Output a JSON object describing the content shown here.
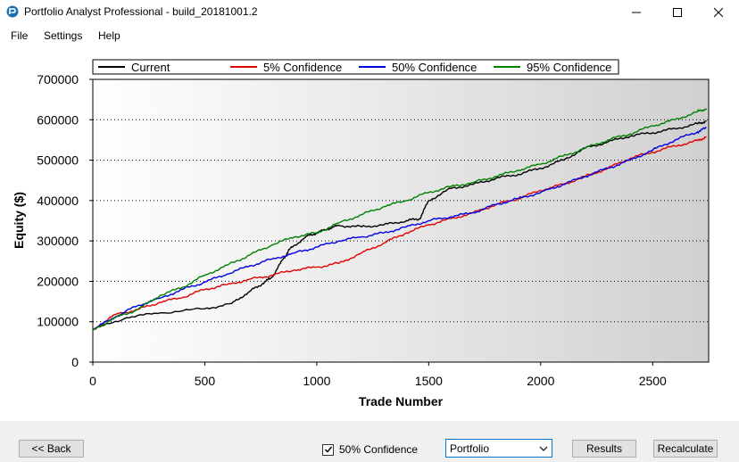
{
  "window": {
    "title": "Portfolio Analyst Professional - build_20181001.2",
    "controls": [
      "minimize",
      "maximize",
      "close"
    ]
  },
  "menu": {
    "items": [
      "File",
      "Settings",
      "Help"
    ]
  },
  "chart_data": {
    "type": "line",
    "title": "",
    "xlabel": "Trade Number",
    "ylabel": "Equity ($)",
    "xlim": [
      0,
      2750
    ],
    "ylim": [
      0,
      700000
    ],
    "xticks": [
      0,
      500,
      1000,
      1500,
      2000,
      2500
    ],
    "yticks": [
      0,
      100000,
      200000,
      300000,
      400000,
      500000,
      600000,
      700000
    ],
    "xtick_labels": [
      "0",
      "500",
      "1000",
      "1500",
      "2000",
      "2500"
    ],
    "ytick_labels": [
      "0",
      "100000",
      "200000",
      "300000",
      "400000",
      "500000",
      "600000",
      "700000"
    ],
    "grid": "horizontal dotted",
    "legend_position": "top",
    "series": [
      {
        "name": "Current",
        "color": "#000000",
        "x": [
          0,
          150,
          300,
          500,
          620,
          700,
          760,
          800,
          850,
          880,
          950,
          1000,
          1050,
          1100,
          1200,
          1300,
          1400,
          1460,
          1500,
          1600,
          1700,
          1800,
          1900,
          2000,
          2100,
          2200,
          2300,
          2400,
          2500,
          2600,
          2700,
          2740
        ],
        "y": [
          80000,
          110000,
          122000,
          132000,
          145000,
          175000,
          195000,
          210000,
          255000,
          280000,
          310000,
          320000,
          330000,
          338000,
          335000,
          340000,
          350000,
          355000,
          400000,
          430000,
          440000,
          455000,
          465000,
          480000,
          500000,
          530000,
          545000,
          560000,
          568000,
          578000,
          590000,
          597000
        ]
      },
      {
        "name": "5% Confidence",
        "color": "#e00000",
        "x": [
          0,
          100,
          200,
          300,
          400,
          500,
          600,
          700,
          800,
          900,
          1000,
          1100,
          1200,
          1300,
          1400,
          1500,
          1600,
          1700,
          1800,
          1900,
          2000,
          2100,
          2200,
          2300,
          2400,
          2500,
          2600,
          2700,
          2740
        ],
        "y": [
          80000,
          118000,
          130000,
          148000,
          160000,
          180000,
          192000,
          205000,
          215000,
          228000,
          235000,
          245000,
          270000,
          295000,
          320000,
          340000,
          355000,
          370000,
          390000,
          405000,
          425000,
          440000,
          460000,
          480000,
          505000,
          520000,
          535000,
          548000,
          558000
        ]
      },
      {
        "name": "50% Confidence",
        "color": "#0000e0",
        "x": [
          0,
          100,
          200,
          300,
          400,
          500,
          600,
          700,
          800,
          900,
          1000,
          1100,
          1200,
          1300,
          1400,
          1500,
          1600,
          1700,
          1800,
          1900,
          2000,
          2100,
          2200,
          2300,
          2400,
          2500,
          2600,
          2700,
          2740
        ],
        "y": [
          80000,
          112000,
          140000,
          158000,
          180000,
          198000,
          218000,
          238000,
          255000,
          270000,
          285000,
          300000,
          310000,
          320000,
          335000,
          350000,
          360000,
          370000,
          390000,
          405000,
          420000,
          440000,
          460000,
          480000,
          500000,
          525000,
          550000,
          570000,
          580000
        ]
      },
      {
        "name": "95% Confidence",
        "color": "#008000",
        "x": [
          0,
          100,
          200,
          300,
          400,
          500,
          600,
          700,
          800,
          900,
          1000,
          1100,
          1200,
          1300,
          1400,
          1500,
          1600,
          1700,
          1800,
          1900,
          2000,
          2100,
          2200,
          2300,
          2400,
          2500,
          2600,
          2700,
          2740
        ],
        "y": [
          80000,
          110000,
          130000,
          165000,
          185000,
          215000,
          240000,
          265000,
          290000,
          310000,
          320000,
          345000,
          365000,
          385000,
          400000,
          420000,
          435000,
          445000,
          460000,
          475000,
          490000,
          510000,
          530000,
          550000,
          565000,
          585000,
          600000,
          620000,
          628000
        ]
      }
    ]
  },
  "footer": {
    "back_label": "<< Back",
    "confidence_label": "50% Confidence",
    "confidence_checked": true,
    "dropdown_value": "Portfolio",
    "results_label": "Results",
    "recalculate_label": "Recalculate"
  },
  "icons": {
    "app": "app-icon",
    "minimize": "minimize-icon",
    "maximize": "maximize-icon",
    "close": "close-icon",
    "check": "check-icon",
    "dropdown": "chevron-down-icon"
  }
}
